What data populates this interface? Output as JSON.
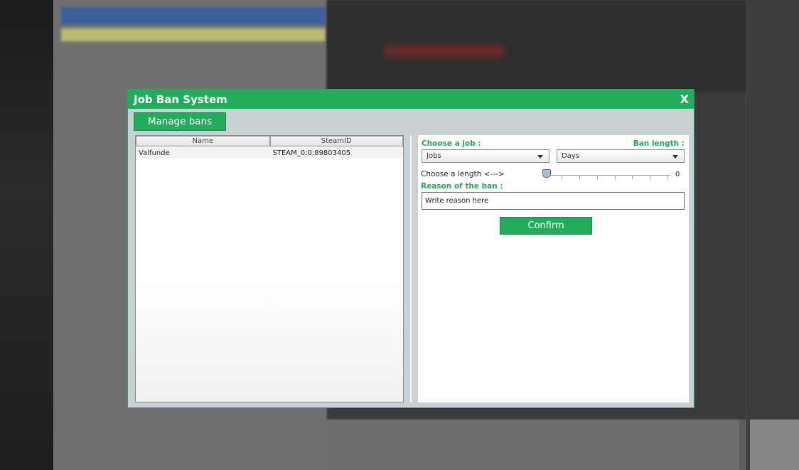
{
  "dialog": {
    "title": "Job Ban System",
    "close_label": "X"
  },
  "tabs": {
    "manage_bans_label": "Manage bans"
  },
  "ban_list": {
    "columns": [
      "Name",
      "SteamID"
    ],
    "rows": [
      {
        "name": "Valfunde",
        "steamid": "STEAM_0:0:89803405"
      }
    ]
  },
  "form": {
    "choose_job_label": "Choose a job :",
    "ban_length_label": "Ban length :",
    "job_selected": "Jobs",
    "length_unit_selected": "Days",
    "choose_length_label": "Choose a length <--->",
    "length_value": "0",
    "reason_label": "Reason of the ban :",
    "reason_value": "Write reason here",
    "confirm_label": "Confirm"
  },
  "colors": {
    "accent": "#21ad5c",
    "panel_bg": "#c9d1d4"
  }
}
